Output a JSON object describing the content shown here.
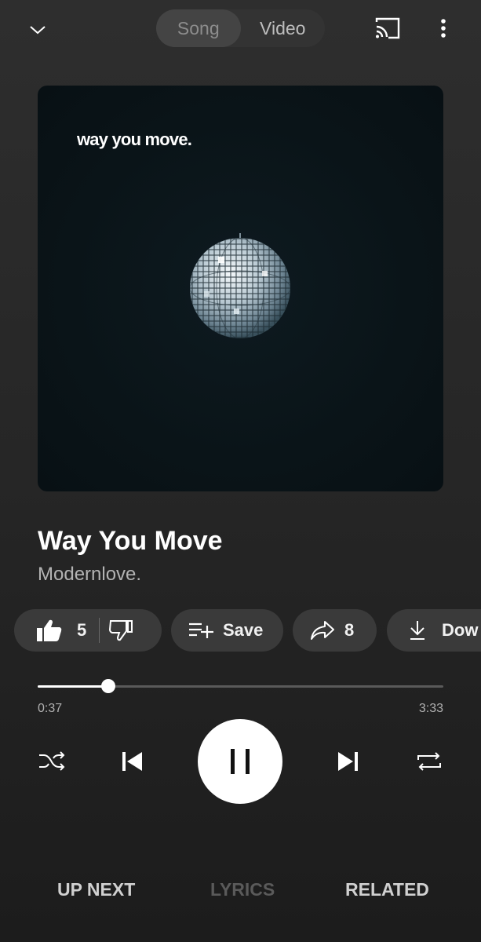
{
  "header": {
    "mode_toggle": {
      "options": [
        "Song",
        "Video"
      ],
      "selected": "Song"
    },
    "icons": {
      "collapse": "chevron-down-icon",
      "cast": "cast-icon",
      "more": "more-vert-icon"
    }
  },
  "artwork": {
    "text": "way you move."
  },
  "track": {
    "title": "Way You Move",
    "artist": "Modernlove."
  },
  "actions": {
    "like_count": "5",
    "save_label": "Save",
    "share_count": "8",
    "download_label": "Dow"
  },
  "progress": {
    "current": "0:37",
    "total": "3:33",
    "fraction": 0.1738
  },
  "colors": {
    "background": "#262626",
    "chip": "#3a3a3a",
    "accent": "#ffffff"
  },
  "tabs": [
    "UP NEXT",
    "LYRICS",
    "RELATED"
  ]
}
